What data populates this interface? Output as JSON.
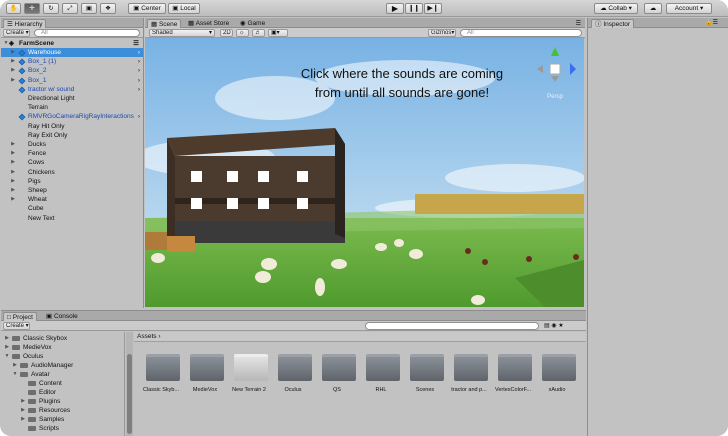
{
  "toolbar": {
    "pivot": "Center",
    "space": "Local",
    "collab": "Collab",
    "account": "Account"
  },
  "hierarchy": {
    "tab": "Hierarchy",
    "create": "Create",
    "search": "All",
    "scene": "FarmScene",
    "items": [
      "Warehouse",
      "Box_1 (1)",
      "Box_2",
      "Box_1",
      "tractor w/ sound",
      "Directional Light",
      "Terrain",
      "RMVRGoCameraRigRayInteractions",
      "Ray Hit Only",
      "Ray Exit Only",
      "Ducks",
      "Fence",
      "Cows",
      "Chickens",
      "Pigs",
      "Sheep",
      "Wheat",
      "Cube",
      "New Text"
    ]
  },
  "scene": {
    "tabs": [
      "Scene",
      "Asset Store",
      "Game"
    ],
    "shading": "Shaded",
    "mode2d": "2D",
    "gizmos": "Gizmos",
    "search": "All",
    "persp": "Persp",
    "message": [
      "Click where the sounds are coming",
      "from until all sounds are gone!"
    ]
  },
  "inspector": {
    "tab": "Inspector"
  },
  "project": {
    "tabs": [
      "Project",
      "Console"
    ],
    "create": "Create",
    "breadcrumb": "Assets",
    "tree": [
      "Classic Skybox",
      "MedieVox",
      "Oculus",
      "AudioManager",
      "Avatar",
      "Content",
      "Editor",
      "Plugins",
      "Resources",
      "Samples",
      "Scripts"
    ],
    "assets": [
      "Classic Skyb...",
      "MedieVox",
      "New Terrain 2",
      "Oculus",
      "QS",
      "RHL",
      "Scenes",
      "tractor and p...",
      "VertexColorF...",
      "xAudio"
    ]
  },
  "colors": {
    "selection": "#3d8eda",
    "prefab": "#1947b8",
    "sky": "#8fc2ea",
    "grass": "#63ad3b"
  }
}
